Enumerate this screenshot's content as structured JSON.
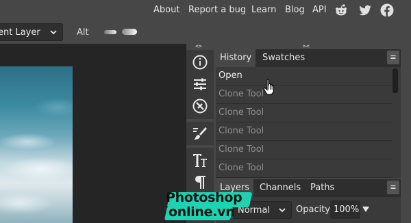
{
  "topnav": {
    "links": [
      "About",
      "Report a bug",
      "Learn",
      "Blog",
      "API"
    ],
    "social_icons": [
      "reddit-icon",
      "twitter-icon",
      "facebook-icon"
    ]
  },
  "options_bar": {
    "layer_select_value": "ent Layer",
    "alt_label": "Alt"
  },
  "tool_strip": {
    "collapse_glyph": "<>",
    "icons": [
      "info-icon",
      "adjustments-icon",
      "navigator-icon",
      "brush-settings-icon",
      "character-icon",
      "paragraph-icon"
    ]
  },
  "history_panel": {
    "collapse_glyph": "><",
    "tabs": [
      "History",
      "Swatches"
    ],
    "menu_glyph": "≡",
    "rows": [
      "Open",
      "Clone Tool",
      "Clone Tool",
      "Clone Tool",
      "Clone Tool",
      "Clone Tool"
    ]
  },
  "layers_panel": {
    "tabs": [
      "Layers",
      "Channels",
      "Paths"
    ],
    "menu_glyph": "≡",
    "blend_mode": "Normal",
    "opacity_label": "Opacity:",
    "opacity_value": "100%"
  },
  "watermark": {
    "line1": "Photoshop",
    "line2": "online.vn"
  },
  "colors": {
    "chrome": "#474747",
    "panel": "#3a3a3a",
    "workspace": "#252525",
    "logo_accent": "#1ed3b4"
  }
}
